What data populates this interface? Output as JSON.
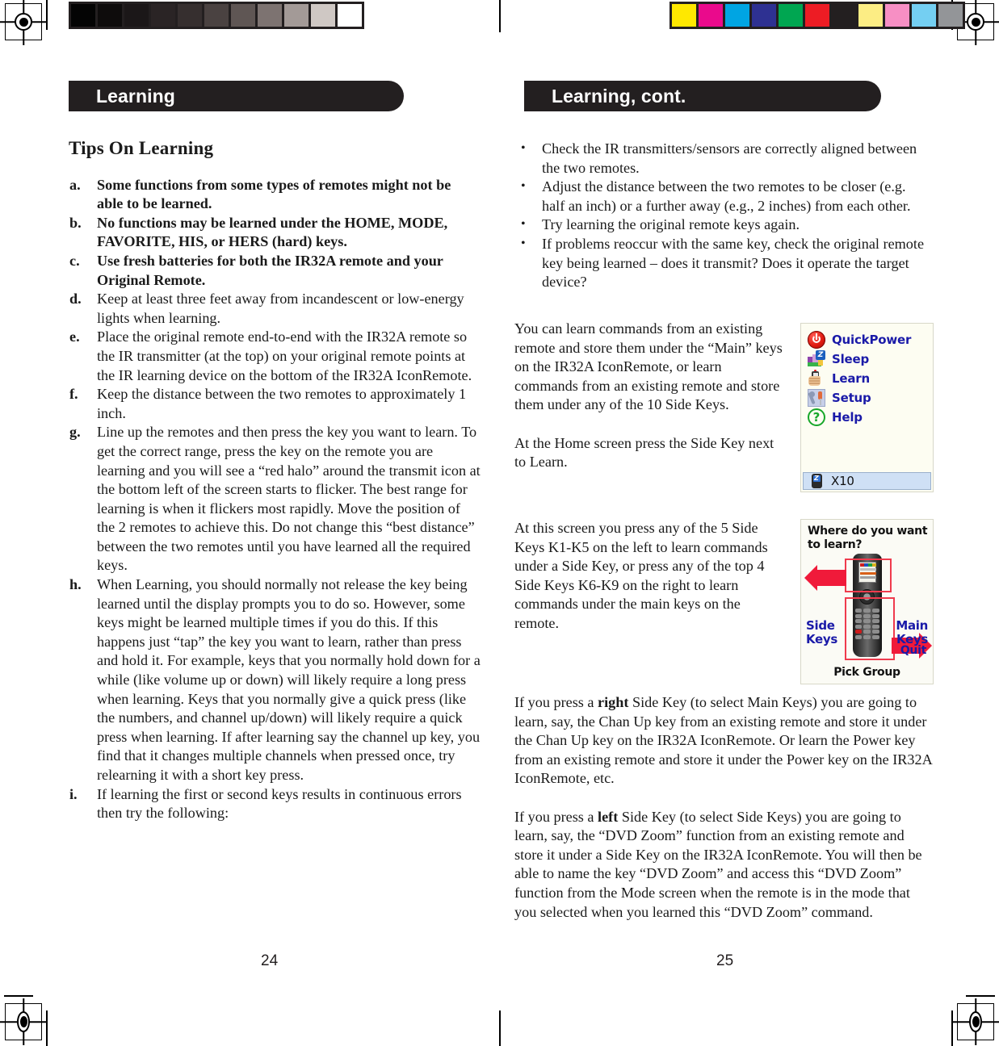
{
  "spread": {
    "left_page": {
      "running_head": "Learning",
      "section_title": "Tips On Learning",
      "folio": "24",
      "tips": [
        {
          "marker": "a.",
          "bold": true,
          "text": "Some functions from some types of remotes might not be able to be learned."
        },
        {
          "marker": "b.",
          "bold": true,
          "text": "No functions may be learned under the HOME, MODE, FAVORITE, HIS, or HERS (hard) keys."
        },
        {
          "marker": "c.",
          "bold": true,
          "text": "Use fresh batteries for both the IR32A remote and your Original Remote."
        },
        {
          "marker": "d.",
          "bold": false,
          "text": "Keep at least three feet away from incandescent or low-energy lights when learning."
        },
        {
          "marker": "e.",
          "bold": false,
          "text": "Place the original remote end-to-end with the IR32A remote so the IR transmitter (at the top) on your original remote points at the IR learning device on the bottom of the IR32A IconRemote."
        },
        {
          "marker": "f.",
          "bold": false,
          "text": "Keep the distance between the two remotes to approximately 1 inch."
        },
        {
          "marker": "g.",
          "bold": false,
          "text": "Line up the remotes and then press the key you want to learn. To get the correct range, press the key on the remote you are learning and you will see a “red halo” around the transmit icon at the bottom left of the screen starts to flicker. The best range for learning is when it flickers most rapidly. Move the position of the 2 remotes to achieve this. Do not change this “best distance” between the two remotes until you have learned all the required keys."
        },
        {
          "marker": "h.",
          "bold": false,
          "text": "When Learning, you should  normally not release the key being learned until the display prompts you to do so. However, some keys might be learned multiple times if you do this. If this happens just “tap” the key you want to learn, rather than press and hold it. For example, keys that you normally hold down for a while (like volume up or down) will likely require a long press when learning. Keys that you normally give a quick press (like the numbers, and channel up/down) will likely require a quick press when learning. If after learning say the channel up key, you find that it changes multiple channels when pressed once, try relearning it with a short key press."
        },
        {
          "marker": "i.",
          "bold": false,
          "text": "If learning the first or second keys results in continuous errors then try the following:"
        }
      ]
    },
    "right_page": {
      "running_head": "Learning, cont.",
      "folio": "25",
      "bullets": [
        {
          "marker": "•",
          "text": "Check the IR transmitters/sensors are correctly aligned between the two remotes."
        },
        {
          "marker": "•",
          "text": "Adjust the distance between the two remotes to be closer (e.g. half an inch) or a further away (e.g., 2 inches) from each other."
        },
        {
          "marker": "•",
          "text": "Try learning the original remote keys again."
        },
        {
          "marker": "•",
          "text": "If problems reoccur with the same key, check the original remote key being learned – does it transmit? Does it operate the target device?"
        }
      ],
      "paragraph_1": "You can learn commands from an existing remote and store them under the “Main” keys on the IR32A IconRemote, or learn commands from an existing remote and store them under any of the 10 Side Keys.",
      "paragraph_2": "At the Home screen press the Side Key next to Learn.",
      "paragraph_3": "At this screen you press any of the 5 Side Keys K1-K5 on the left to learn commands under a Side Key, or press any of the top 4 Side Keys K6-K9 on the right to learn commands under the main keys on the remote.",
      "paragraph_4_pre": "If you press a ",
      "paragraph_4_bold": "right",
      "paragraph_4_post": " Side Key (to select Main Keys) you are going to learn, say, the Chan Up key from an existing remote and store it under the Chan Up key on the IR32A IconRemote. Or learn the Power key from an existing remote and store it under the Power key on the IR32A IconRemote, etc.",
      "paragraph_5_pre": "If you press a ",
      "paragraph_5_bold": "left",
      "paragraph_5_post": " Side Key (to select Side Keys) you are going to learn, say, the “DVD Zoom” function from an existing remote and store it under a Side Key on the IR32A IconRemote. You will then be able to name the key “DVD Zoom” and access this “DVD Zoom” function from the Mode screen when the remote is in the mode that you selected when you learned this “DVD Zoom” command."
    }
  },
  "home_menu_screenshot": {
    "items": [
      {
        "icon": "power-icon",
        "label": "QuickPower"
      },
      {
        "icon": "sleep-icon",
        "label": "Sleep"
      },
      {
        "icon": "learn-icon",
        "label": "Learn"
      },
      {
        "icon": "setup-icon",
        "label": "Setup"
      },
      {
        "icon": "help-icon",
        "label": "Help"
      }
    ],
    "status_bar": {
      "icon": "x10-remote-icon",
      "label": "X10"
    },
    "label_color": "#1a1aa8",
    "status_bg": "#cfe0f5"
  },
  "learn_target_screenshot": {
    "title": "Where do you want to learn?",
    "left_label": "Side\nKeys",
    "left_label_line1": "Side",
    "left_label_line2": "Keys",
    "right_label_line1": "Main",
    "right_label_line2": "Keys",
    "quit_label": "Quit",
    "footer_label": "Pick Group",
    "accent_color": "#f01a3a",
    "label_color": "#1a1aa8"
  },
  "print_marks": {
    "grayscale_swatches": [
      "#040404",
      "#0e0c0c",
      "#1b1718",
      "#2a2425",
      "#362f2f",
      "#4a4241",
      "#5f5654",
      "#7d7371",
      "#a39a97",
      "#cfc8c4",
      "#ffffff"
    ],
    "color_swatches": [
      "#ffe800",
      "#ea0a8c",
      "#00a5e3",
      "#2e3192",
      "#00a651",
      "#ed1c24",
      "#231f20",
      "#fced84",
      "#f78fc4",
      "#74cff2",
      "#939598"
    ]
  }
}
